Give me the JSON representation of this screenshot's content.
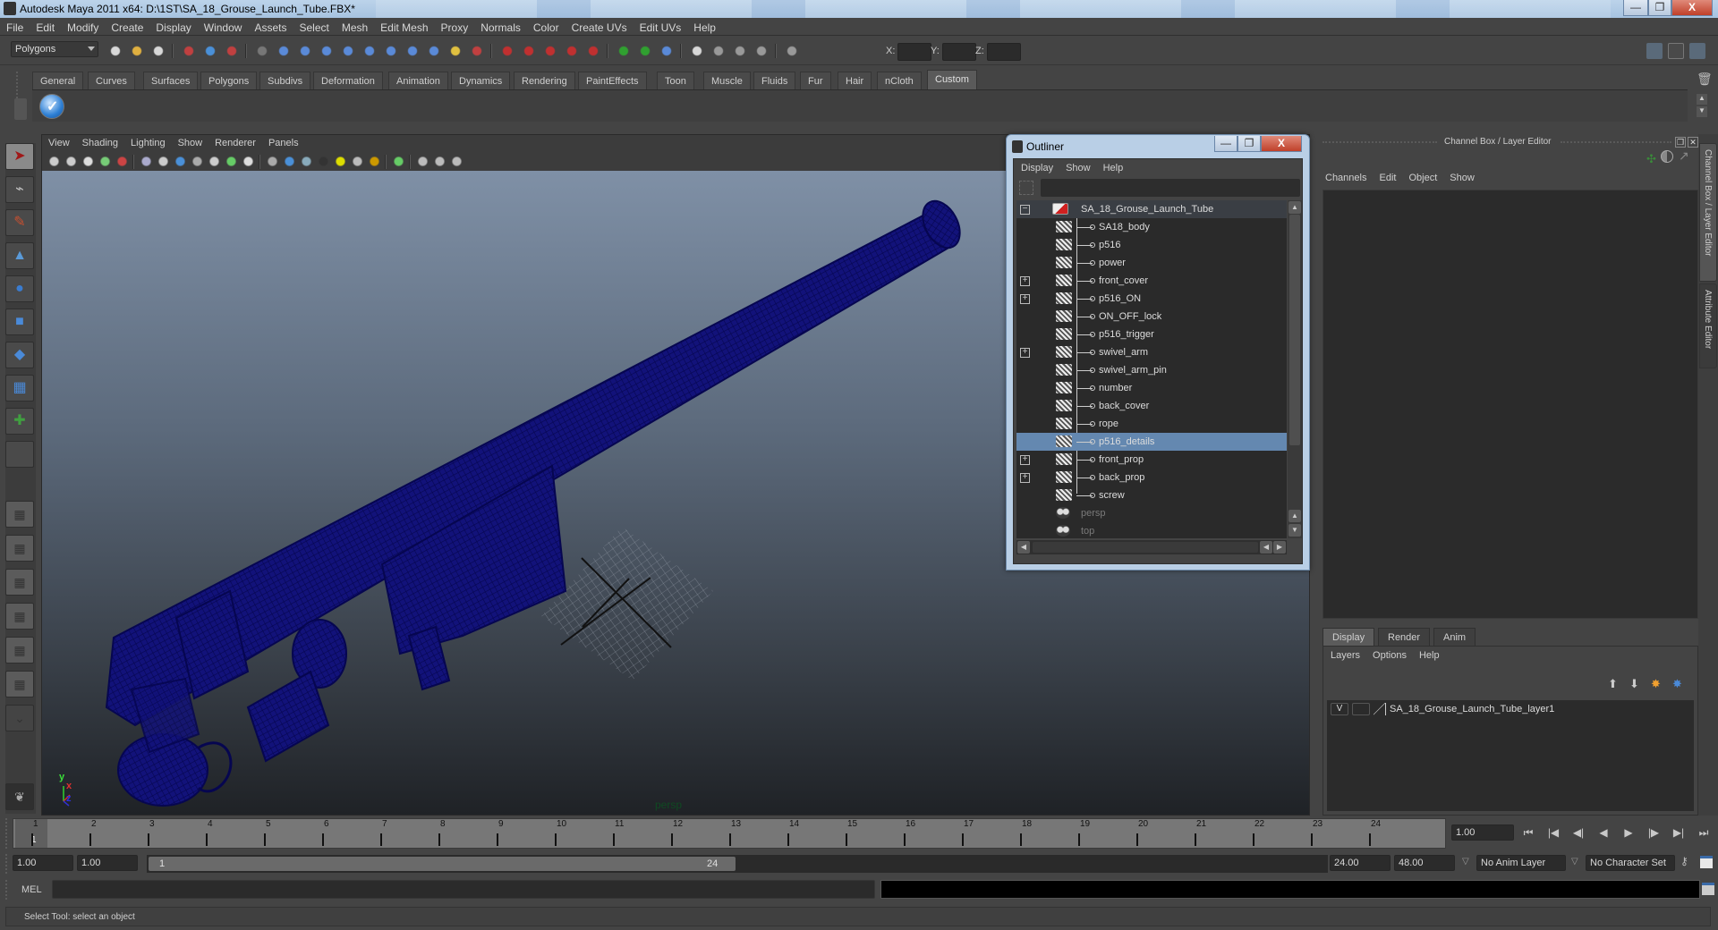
{
  "window": {
    "title": "Autodesk Maya 2011 x64: D:\\1ST\\SA_18_Grouse_Launch_Tube.FBX*",
    "controls": {
      "minimize": "—",
      "restore": "❐",
      "close": "X"
    }
  },
  "menubar": [
    "File",
    "Edit",
    "Modify",
    "Create",
    "Display",
    "Window",
    "Assets",
    "Select",
    "Mesh",
    "Edit Mesh",
    "Proxy",
    "Normals",
    "Color",
    "Create UVs",
    "Edit UVs",
    "Help"
  ],
  "statusline": {
    "menu_set": "Polygons",
    "xyz_labels": [
      "X:",
      "Y:",
      "Z:"
    ],
    "xyz_values": [
      "",
      "",
      ""
    ]
  },
  "shelf": {
    "tabs": [
      "General",
      "Curves",
      "Surfaces",
      "Polygons",
      "Subdivs",
      "Deformation",
      "Animation",
      "Dynamics",
      "Rendering",
      "PaintEffects",
      "Toon",
      "Muscle",
      "Fluids",
      "Fur",
      "Hair",
      "nCloth",
      "Custom"
    ],
    "active_tab": "Custom"
  },
  "toolbox": {
    "tools": [
      {
        "name": "select-tool",
        "glyph": "➤",
        "color": "#a01818",
        "active": true
      },
      {
        "name": "lasso-tool",
        "glyph": "⌁",
        "color": "#c0c0c0"
      },
      {
        "name": "paint-select-tool",
        "glyph": "✎",
        "color": "#c85030"
      },
      {
        "name": "move-tool-soft",
        "glyph": "▲",
        "color": "#5a9ad8"
      },
      {
        "name": "rotate-tool",
        "glyph": "●",
        "color": "#3a7cd0"
      },
      {
        "name": "scale-tool",
        "glyph": "■",
        "color": "#4a8ad8"
      },
      {
        "name": "universal-manipulator",
        "glyph": "◆",
        "color": "#4a8ad8"
      },
      {
        "name": "soft-modification-tool",
        "glyph": "▦",
        "color": "#4a8ad8"
      },
      {
        "name": "show-manipulator-tool",
        "glyph": "✚",
        "color": "#40a040"
      },
      {
        "name": "last-tool-used",
        "glyph": "",
        "color": "#888"
      }
    ],
    "layouts": [
      "single-perspective-layout",
      "four-view-layout",
      "outliner-persp-layout",
      "persp-graph-layout",
      "hypershade-persp-layout",
      "persp-graph-hypergraph-layout"
    ]
  },
  "viewport": {
    "menu": [
      "View",
      "Shading",
      "Lighting",
      "Show",
      "Renderer",
      "Panels"
    ],
    "camera_label": "persp",
    "axis": {
      "y": "y",
      "x": "x",
      "z": "z"
    },
    "mesh_color": "#0a0a6e"
  },
  "outliner": {
    "title": "Outliner",
    "menu": [
      "Display",
      "Show",
      "Help"
    ],
    "items": [
      {
        "label": "SA_18_Grouse_Launch_Tube",
        "type": "root",
        "expander": "−"
      },
      {
        "label": "SA18_body",
        "type": "mesh",
        "expander": ""
      },
      {
        "label": "p516",
        "type": "mesh",
        "expander": ""
      },
      {
        "label": "power",
        "type": "mesh",
        "expander": ""
      },
      {
        "label": "front_cover",
        "type": "mesh",
        "expander": "+"
      },
      {
        "label": "p516_ON",
        "type": "mesh",
        "expander": "+"
      },
      {
        "label": "ON_OFF_lock",
        "type": "mesh",
        "expander": ""
      },
      {
        "label": "p516_trigger",
        "type": "mesh",
        "expander": ""
      },
      {
        "label": "swivel_arm",
        "type": "mesh",
        "expander": "+"
      },
      {
        "label": "swivel_arm_pin",
        "type": "mesh",
        "expander": ""
      },
      {
        "label": "number",
        "type": "mesh",
        "expander": ""
      },
      {
        "label": "back_cover",
        "type": "mesh",
        "expander": ""
      },
      {
        "label": "rope",
        "type": "mesh",
        "expander": ""
      },
      {
        "label": "p516_details",
        "type": "mesh",
        "expander": "",
        "selected": true
      },
      {
        "label": "front_prop",
        "type": "mesh",
        "expander": "+"
      },
      {
        "label": "back_prop",
        "type": "mesh",
        "expander": "+"
      },
      {
        "label": "screw",
        "type": "mesh",
        "expander": ""
      },
      {
        "label": "persp",
        "type": "camera",
        "expander": ""
      },
      {
        "label": "top",
        "type": "camera",
        "expander": ""
      }
    ]
  },
  "channel_box": {
    "title": "Channel Box / Layer Editor",
    "menu": [
      "Channels",
      "Edit",
      "Object",
      "Show"
    ]
  },
  "layer_editor": {
    "tabs": [
      "Display",
      "Render",
      "Anim"
    ],
    "active_tab": "Display",
    "menu": [
      "Layers",
      "Options",
      "Help"
    ],
    "layers": [
      {
        "visible": "V",
        "type": "",
        "name": "SA_18_Grouse_Launch_Tube_layer1"
      }
    ]
  },
  "side_tabs": [
    "Channel Box / Layer Editor",
    "Attribute Editor"
  ],
  "timeline": {
    "ticks": [
      "1",
      "2",
      "3",
      "4",
      "5",
      "6",
      "7",
      "8",
      "9",
      "10",
      "11",
      "12",
      "13",
      "14",
      "15",
      "16",
      "17",
      "18",
      "19",
      "20",
      "21",
      "22",
      "23",
      "24"
    ],
    "current_frame": "1",
    "current_time_field": "1.00",
    "playback_buttons": [
      "⏮",
      "|◀",
      "◀|",
      "◀",
      "▶",
      "|▶",
      "▶|",
      "⏭"
    ]
  },
  "range": {
    "start_time": "1.00",
    "playback_start": "1.00",
    "range_start_label": "1",
    "range_end_label": "24",
    "playback_end": "24.00",
    "end_time": "48.00",
    "anim_layer": "No Anim Layer",
    "character_set": "No Character Set"
  },
  "command_line": {
    "label": "MEL",
    "input": "",
    "output": ""
  },
  "help_line": "Select Tool: select an object"
}
